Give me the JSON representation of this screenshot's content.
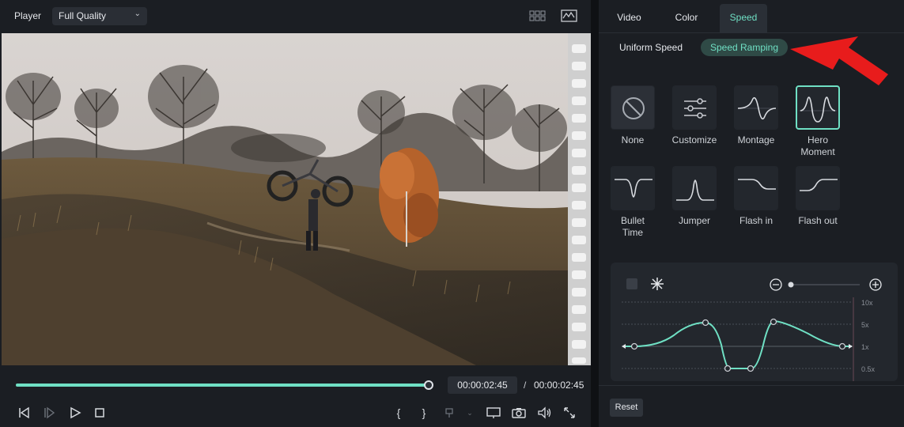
{
  "player": {
    "label": "Player",
    "quality": "Full Quality",
    "time_current": "00:00:02:45",
    "time_separator": "/",
    "time_total": "00:00:02:45",
    "progress": 1.0,
    "mark_in": "{",
    "mark_out": "}"
  },
  "panel": {
    "tabs": [
      {
        "label": "Video"
      },
      {
        "label": "Color"
      },
      {
        "label": "Speed"
      }
    ],
    "active_tab": "Speed",
    "modes": {
      "uniform": "Uniform Speed",
      "ramping": "Speed Ramping"
    },
    "presets": [
      {
        "label": "None"
      },
      {
        "label": "Customize"
      },
      {
        "label": "Montage"
      },
      {
        "label": "Hero\nMoment"
      },
      {
        "label": "Bullet\nTime"
      },
      {
        "label": "Jumper"
      },
      {
        "label": "Flash in"
      },
      {
        "label": "Flash out"
      }
    ],
    "selected_preset": "Hero Moment",
    "curve": {
      "y_labels": [
        "10x",
        "5x",
        "1x",
        "0.5x"
      ]
    },
    "reset_label": "Reset"
  },
  "colors": {
    "accent": "#6fe0c4",
    "arrow": "#e81c1c"
  }
}
